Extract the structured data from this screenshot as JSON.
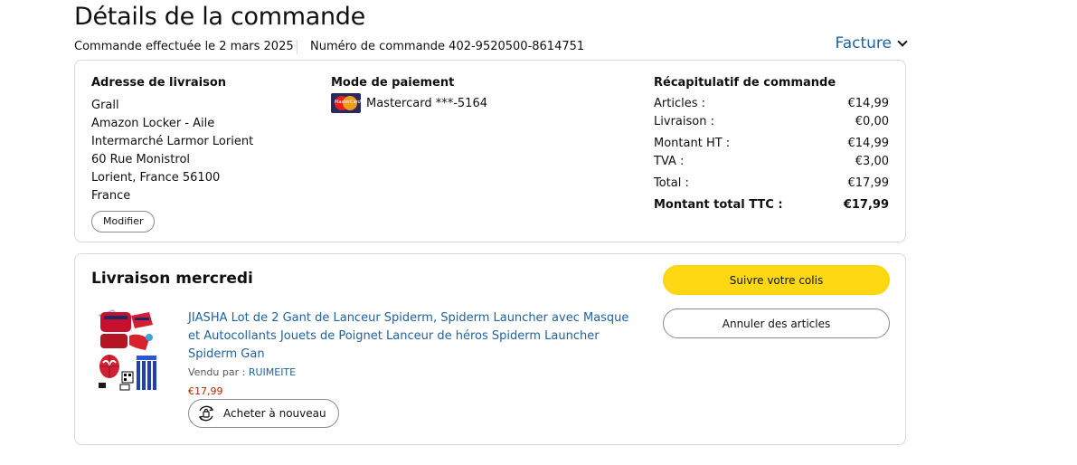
{
  "header": {
    "title": "Détails de la commande",
    "order_date": "Commande effectuée le 2 mars 2025",
    "order_number": "Numéro de commande 402-9520500-8614751",
    "invoice_label": "Facture"
  },
  "shipping": {
    "title": "Adresse de livraison",
    "lines": [
      "Grall",
      "Amazon Locker - Aile",
      "Intermarché Larmor Lorient",
      "60 Rue Monistrol",
      "Lorient, France 56100",
      "France"
    ],
    "modify_label": "Modifier"
  },
  "payment": {
    "title": "Mode de paiement",
    "card_brand_icon": "mastercard-icon",
    "card_label": "Mastercard ***-5164",
    "card_logo_text": "MasterCard"
  },
  "summary": {
    "title": "Récapitulatif de commande",
    "rows": [
      {
        "label": "Articles :",
        "value": "€14,99"
      },
      {
        "label": "Livraison :",
        "value": "€0,00"
      },
      {
        "label": "Montant HT :",
        "value": "€14,99"
      },
      {
        "label": "TVA :",
        "value": "€3,00"
      },
      {
        "label": "Total :",
        "value": "€17,99"
      },
      {
        "label": "Montant total TTC :",
        "value": "€17,99"
      }
    ]
  },
  "delivery": {
    "title": "Livraison mercredi",
    "track_label": "Suivre votre colis",
    "cancel_label": "Annuler des articles",
    "item": {
      "title": "JIASHA Lot de 2 Gant de Lanceur Spiderm, Spiderm Launcher avec Masque et Autocollants Jouets de Poignet Lanceur de héros Spiderm Launcher Spiderm Gan",
      "seller_prefix": "Vendu par :",
      "seller_name": "RUIMEITE",
      "price": "€17,99",
      "buy_again_label": "Acheter à nouveau"
    }
  },
  "colors": {
    "link": "#2162a1",
    "price": "#b12704",
    "primary_button": "#ffd814",
    "border": "#d5d9d9"
  }
}
